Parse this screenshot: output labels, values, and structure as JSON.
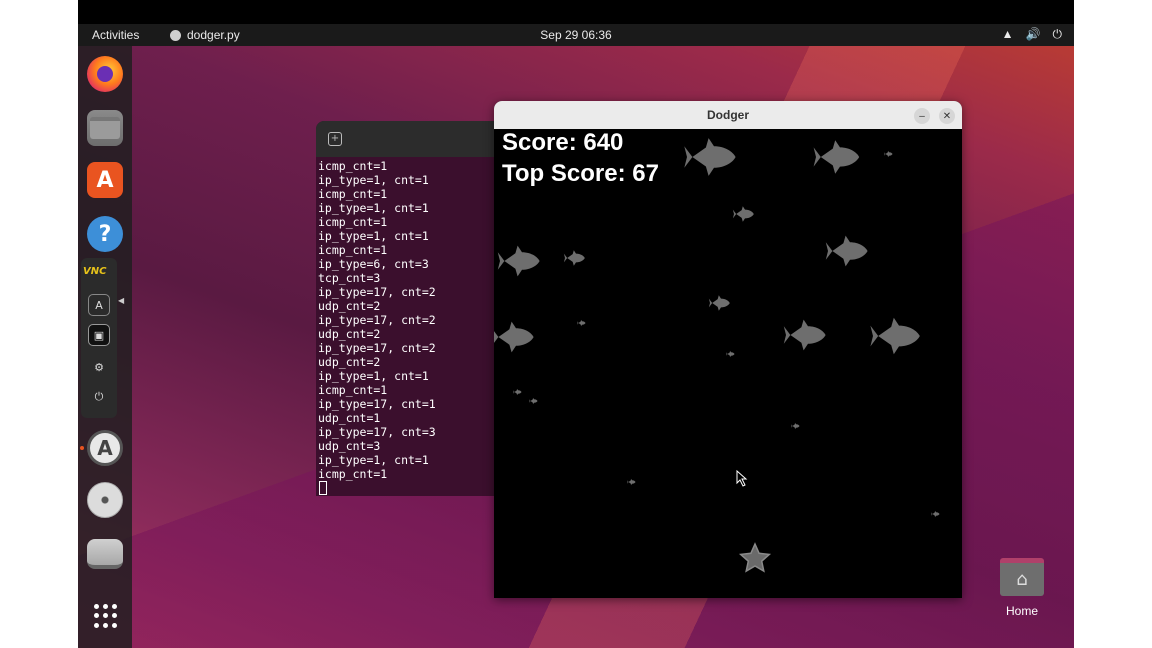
{
  "topbar": {
    "activities": "Activities",
    "app_name": "dodger.py",
    "clock": "Sep 29  06:36",
    "tray": [
      "network-icon",
      "volume-icon",
      "power-icon"
    ]
  },
  "dock": {
    "vnc_label": "VNC",
    "items": [
      "firefox-icon",
      "files-icon",
      "app-center-icon",
      "help-icon",
      "software-updater-icon",
      "disc-icon",
      "drive-icon",
      "show-apps-icon"
    ]
  },
  "terminal": {
    "lines": [
      "icmp_cnt=1",
      "ip_type=1, cnt=1",
      "icmp_cnt=1",
      "ip_type=1, cnt=1",
      "icmp_cnt=1",
      "ip_type=1, cnt=1",
      "icmp_cnt=1",
      "ip_type=6, cnt=3",
      "tcp_cnt=3",
      "ip_type=17, cnt=2",
      "udp_cnt=2",
      "ip_type=17, cnt=2",
      "udp_cnt=2",
      "ip_type=17, cnt=2",
      "udp_cnt=2",
      "ip_type=1, cnt=1",
      "icmp_cnt=1",
      "ip_type=17, cnt=1",
      "udp_cnt=1",
      "ip_type=17, cnt=3",
      "udp_cnt=3",
      "ip_type=1, cnt=1",
      "icmp_cnt=1"
    ]
  },
  "dodger": {
    "title": "Dodger",
    "score": "Score: 640",
    "top_score": "Top Score: 67",
    "colors": {
      "fish": "#6e6e6e",
      "background": "#000000"
    }
  },
  "desktop": {
    "home_label": "Home"
  }
}
